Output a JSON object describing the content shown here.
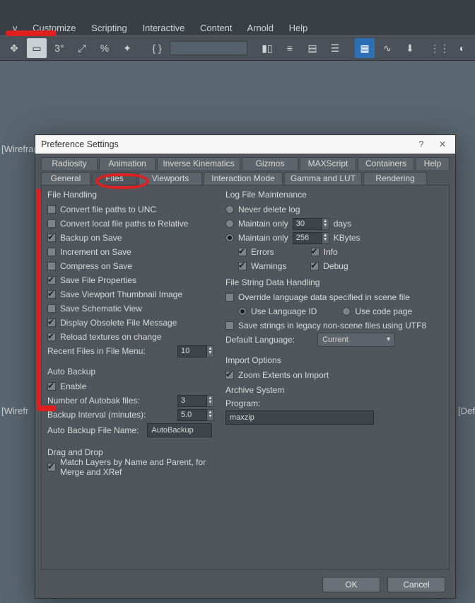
{
  "menubar": [
    "v",
    "Customize",
    "Scripting",
    "Interactive",
    "Content",
    "Arnold",
    "Help"
  ],
  "viewport_labels": {
    "top": "[Wirefram",
    "bottom_left": "[Wirefr",
    "bottom_right": "[Def"
  },
  "dialog": {
    "title": "Preference Settings",
    "help_glyph": "?",
    "close_glyph": "✕",
    "tabs_row1": [
      "Radiosity",
      "Animation",
      "Inverse Kinematics",
      "Gizmos",
      "MAXScript",
      "Containers",
      "Help"
    ],
    "tabs_row2": [
      "General",
      "Files",
      "Viewports",
      "Interaction Mode",
      "Gamma and LUT",
      "Rendering"
    ],
    "active_tab": "Files",
    "file_handling": {
      "title": "File Handling",
      "items": [
        {
          "label": "Convert file paths to UNC",
          "checked": false
        },
        {
          "label": "Convert local file paths to Relative",
          "checked": false
        },
        {
          "label": "Backup on Save",
          "checked": true
        },
        {
          "label": "Increment on Save",
          "checked": false
        },
        {
          "label": "Compress on Save",
          "checked": false
        },
        {
          "label": "Save File Properties",
          "checked": true
        },
        {
          "label": "Save Viewport Thumbnail Image",
          "checked": true
        },
        {
          "label": "Save Schematic View",
          "checked": false
        },
        {
          "label": "Display Obsolete File Message",
          "checked": true
        },
        {
          "label": "Reload textures on change",
          "checked": true
        }
      ],
      "recent_label": "Recent Files in File Menu:",
      "recent_value": "10"
    },
    "auto_backup": {
      "title": "Auto Backup",
      "enable_label": "Enable",
      "enable_checked": true,
      "num_label": "Number of Autobak files:",
      "num_value": "3",
      "interval_label": "Backup Interval (minutes):",
      "interval_value": "5.0",
      "name_label": "Auto Backup File Name:",
      "name_value": "AutoBackup"
    },
    "drag_drop": {
      "title": "Drag and Drop",
      "item_label": "Match Layers by Name and Parent, for Merge and XRef",
      "item_checked": true
    },
    "log": {
      "title": "Log File Maintenance",
      "never_label": "Never delete log",
      "maintain_days_label": "Maintain only",
      "maintain_days_value": "30",
      "days_suffix": "days",
      "maintain_kb_label": "Maintain only",
      "maintain_kb_value": "256",
      "kb_suffix": "KBytes",
      "selected": "kb",
      "errors": {
        "label": "Errors",
        "checked": true
      },
      "info": {
        "label": "Info",
        "checked": true
      },
      "warnings": {
        "label": "Warnings",
        "checked": true
      },
      "debug": {
        "label": "Debug",
        "checked": true
      }
    },
    "string_handling": {
      "title": "File String Data Handling",
      "override_label": "Override language data specified in scene file",
      "override_checked": false,
      "langid_label": "Use Language ID",
      "codepage_label": "Use code page",
      "string_selected": "langid",
      "utf8_label": "Save strings in legacy non-scene files using UTF8",
      "utf8_checked": false,
      "default_lang_label": "Default Language:",
      "default_lang_value": "Current"
    },
    "import": {
      "title": "Import Options",
      "zoom_label": "Zoom Extents on Import",
      "zoom_checked": true
    },
    "archive": {
      "title": "Archive System",
      "program_label": "Program:",
      "program_value": "maxzip"
    },
    "buttons": {
      "ok": "OK",
      "cancel": "Cancel"
    }
  }
}
